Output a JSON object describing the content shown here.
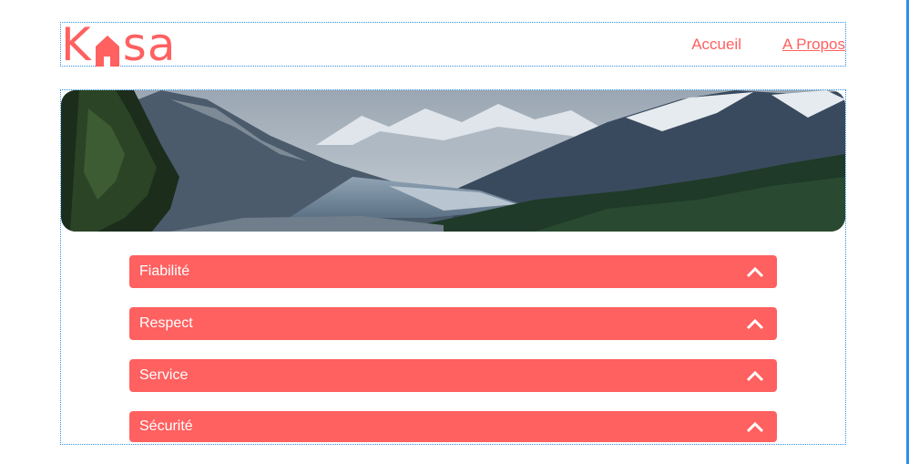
{
  "brand": {
    "logo_text_left": "K",
    "logo_text_right": "sa",
    "color": "#ff6060"
  },
  "nav": {
    "items": [
      {
        "label": "Accueil"
      },
      {
        "label": "A Propos"
      }
    ]
  },
  "accordion": {
    "items": [
      {
        "title": "Fiabilité"
      },
      {
        "title": "Respect"
      },
      {
        "title": "Service"
      },
      {
        "title": "Sécurité"
      }
    ]
  },
  "icons": {
    "collapse_toggle": "chevron-up-icon",
    "logo_house": "house-icon"
  }
}
